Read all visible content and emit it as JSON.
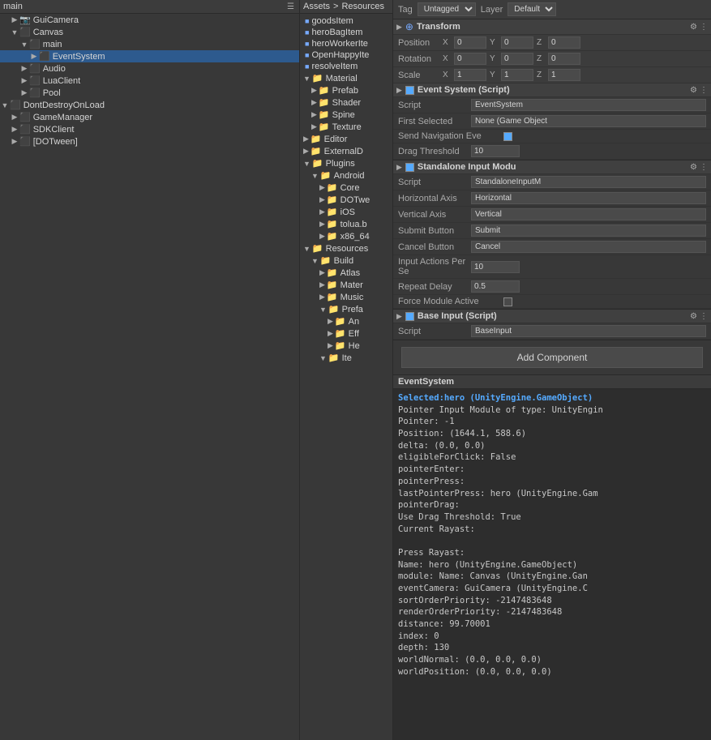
{
  "leftPanel": {
    "title": "main",
    "tree": [
      {
        "id": "guicamera",
        "label": "GuiCamera",
        "indent": 1,
        "expand": false,
        "icon": "camera",
        "selected": false
      },
      {
        "id": "canvas",
        "label": "Canvas",
        "indent": 1,
        "expand": true,
        "icon": "canvas",
        "selected": false
      },
      {
        "id": "main-child",
        "label": "main",
        "indent": 2,
        "expand": true,
        "icon": "obj",
        "selected": false
      },
      {
        "id": "eventsystem",
        "label": "EventSystem",
        "indent": 3,
        "expand": false,
        "icon": "obj",
        "selected": true
      },
      {
        "id": "audio",
        "label": "Audio",
        "indent": 2,
        "expand": false,
        "icon": "obj",
        "selected": false
      },
      {
        "id": "luaclient",
        "label": "LuaClient",
        "indent": 2,
        "expand": false,
        "icon": "obj",
        "selected": false
      },
      {
        "id": "pool",
        "label": "Pool",
        "indent": 2,
        "expand": false,
        "icon": "obj",
        "selected": false
      },
      {
        "id": "dontdestroy",
        "label": "DontDestroyOnLoad",
        "indent": 0,
        "expand": true,
        "icon": "obj",
        "selected": false
      },
      {
        "id": "gamemanager",
        "label": "GameManager",
        "indent": 1,
        "expand": false,
        "icon": "obj",
        "selected": false
      },
      {
        "id": "sdkclient",
        "label": "SDKClient",
        "indent": 1,
        "expand": false,
        "icon": "obj",
        "selected": false
      },
      {
        "id": "dotween",
        "label": "[DOTween]",
        "indent": 1,
        "expand": false,
        "icon": "obj",
        "selected": false
      }
    ]
  },
  "middlePanel": {
    "assetsLabel": "Assets",
    "resourcesLabel": "Resources",
    "folders": [
      {
        "label": "Material",
        "indent": 0,
        "expanded": true
      },
      {
        "label": "Prefab",
        "indent": 1,
        "expanded": false
      },
      {
        "label": "Shader",
        "indent": 1,
        "expanded": false
      },
      {
        "label": "Spine",
        "indent": 1,
        "expanded": false
      },
      {
        "label": "Texture",
        "indent": 1,
        "expanded": false
      },
      {
        "label": "Editor",
        "indent": 0,
        "expanded": false
      },
      {
        "label": "ExternalD",
        "indent": 0,
        "expanded": false
      },
      {
        "label": "Plugins",
        "indent": 0,
        "expanded": true
      },
      {
        "label": "Android",
        "indent": 1,
        "expanded": true
      },
      {
        "label": "Core",
        "indent": 2,
        "expanded": false
      },
      {
        "label": "DOTwe",
        "indent": 2,
        "expanded": false
      },
      {
        "label": "iOS",
        "indent": 2,
        "expanded": false
      },
      {
        "label": "tolua.b",
        "indent": 2,
        "expanded": false
      },
      {
        "label": "x86_64",
        "indent": 2,
        "expanded": false
      },
      {
        "label": "Resources",
        "indent": 0,
        "expanded": true
      },
      {
        "label": "Build",
        "indent": 1,
        "expanded": true
      },
      {
        "label": "Atlas",
        "indent": 2,
        "expanded": false
      },
      {
        "label": "Mater",
        "indent": 2,
        "expanded": false
      },
      {
        "label": "Music",
        "indent": 2,
        "expanded": false
      },
      {
        "label": "Prefa",
        "indent": 2,
        "expanded": true
      },
      {
        "label": "An",
        "indent": 3,
        "expanded": false
      },
      {
        "label": "Eff",
        "indent": 3,
        "expanded": false
      },
      {
        "label": "He",
        "indent": 3,
        "expanded": false
      },
      {
        "label": "Ite",
        "indent": 2,
        "expanded": true
      }
    ],
    "assetFiles": [
      {
        "label": "goodsItem"
      },
      {
        "label": "heroBagItem"
      },
      {
        "label": "heroWorkerIte"
      },
      {
        "label": "OpenHappyIte"
      },
      {
        "label": "resolveItem"
      }
    ]
  },
  "inspector": {
    "tagLabel": "Tag",
    "tagValue": "Untagged",
    "layerLabel": "Layer",
    "layerValue": "Default",
    "transform": {
      "title": "Transform",
      "position": {
        "label": "Position",
        "x": "0",
        "y": "0",
        "z": "0"
      },
      "rotation": {
        "label": "Rotation",
        "x": "0",
        "y": "0",
        "z": "0"
      },
      "scale": {
        "label": "Scale",
        "x": "1",
        "y": "1",
        "z": "1"
      }
    },
    "eventSystem": {
      "title": "Event System (Script)",
      "scriptLabel": "Script",
      "scriptValue": "EventSystem",
      "firstSelectedLabel": "First Selected",
      "firstSelectedValue": "None (Game Object",
      "sendNavLabel": "Send Navigation Eve",
      "sendNavChecked": true,
      "dragThresholdLabel": "Drag Threshold",
      "dragThresholdValue": "10"
    },
    "standaloneInput": {
      "title": "Standalone Input Modu",
      "scriptLabel": "Script",
      "scriptValue": "StandaloneInputM",
      "horizontalAxisLabel": "Horizontal Axis",
      "horizontalAxisValue": "Horizontal",
      "verticalAxisLabel": "Vertical Axis",
      "verticalAxisValue": "Vertical",
      "submitButtonLabel": "Submit Button",
      "submitButtonValue": "Submit",
      "cancelButtonLabel": "Cancel Button",
      "cancelButtonValue": "Cancel",
      "inputActionsLabel": "Input Actions Per Se",
      "inputActionsValue": "10",
      "repeatDelayLabel": "Repeat Delay",
      "repeatDelayValue": "0.5",
      "forceModuleLabel": "Force Module Active",
      "forceModuleChecked": false
    },
    "baseInput": {
      "title": "Base Input (Script)",
      "scriptLabel": "Script",
      "scriptValue": "BaseInput"
    },
    "addComponentLabel": "Add Component"
  },
  "console": {
    "title": "EventSystem",
    "selectedLine": "Selected:hero (UnityEngine.GameObject)",
    "lines": [
      "Pointer Input Module of type: UnityEngin",
      "Pointer: -1",
      "Position: (1644.1, 588.6)",
      "delta: (0.0, 0.0)",
      "eligibleForClick: False",
      "pointerEnter:",
      "pointerPress:",
      "lastPointerPress: hero (UnityEngine.Gam",
      "pointerDrag:",
      "Use Drag Threshold: True",
      "Current Rayast:",
      "",
      "Press Rayast:",
      "Name: hero (UnityEngine.GameObject)",
      "module: Name: Canvas (UnityEngine.Gan",
      "eventCamera: GuiCamera (UnityEngine.C",
      "sortOrderPriority: -2147483648",
      "renderOrderPriority: -2147483648",
      "distance: 99.70001",
      "index: 0",
      "depth: 130",
      "worldNormal: (0.0, 0.0, 0.0)",
      "worldPosition: (0.0, 0.0, 0.0)"
    ]
  }
}
